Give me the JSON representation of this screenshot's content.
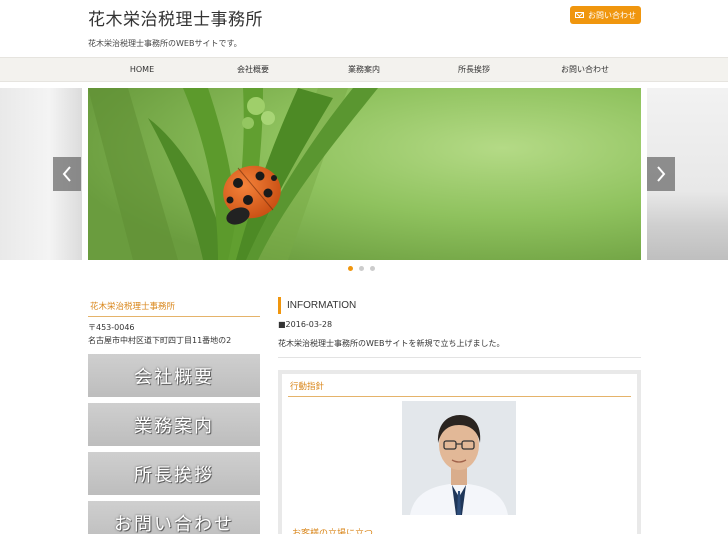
{
  "header": {
    "site_title": "花木栄治税理士事務所",
    "tagline": "花木栄治税理士事務所のWEBサイトです。",
    "contact_button": "お問い合わせ"
  },
  "nav": {
    "items": [
      {
        "label": "HOME"
      },
      {
        "label": "会社概要"
      },
      {
        "label": "業務案内"
      },
      {
        "label": "所長挨拶"
      },
      {
        "label": "お問い合わせ"
      }
    ]
  },
  "slider": {
    "active_slide": 1,
    "slide_count": 3
  },
  "sidebar": {
    "office_name": "花木栄治税理士事務所",
    "postal": "〒453-0046",
    "address": "名古屋市中村区道下町四丁目11番地の2",
    "buttons": [
      {
        "label": "会社概要"
      },
      {
        "label": "業務案内"
      },
      {
        "label": "所長挨拶"
      },
      {
        "label": "お問い合わせ"
      }
    ]
  },
  "info": {
    "heading": "INFORMATION",
    "date": "■2016-03-28",
    "text": "花木栄治税理士事務所のWEBサイトを新規で立ち上げました。"
  },
  "principle": {
    "title": "行動指針",
    "subtitle": "お客様の立場に立つ"
  },
  "colors": {
    "accent": "#f0960e",
    "nav_bg": "#f3f2ee"
  }
}
